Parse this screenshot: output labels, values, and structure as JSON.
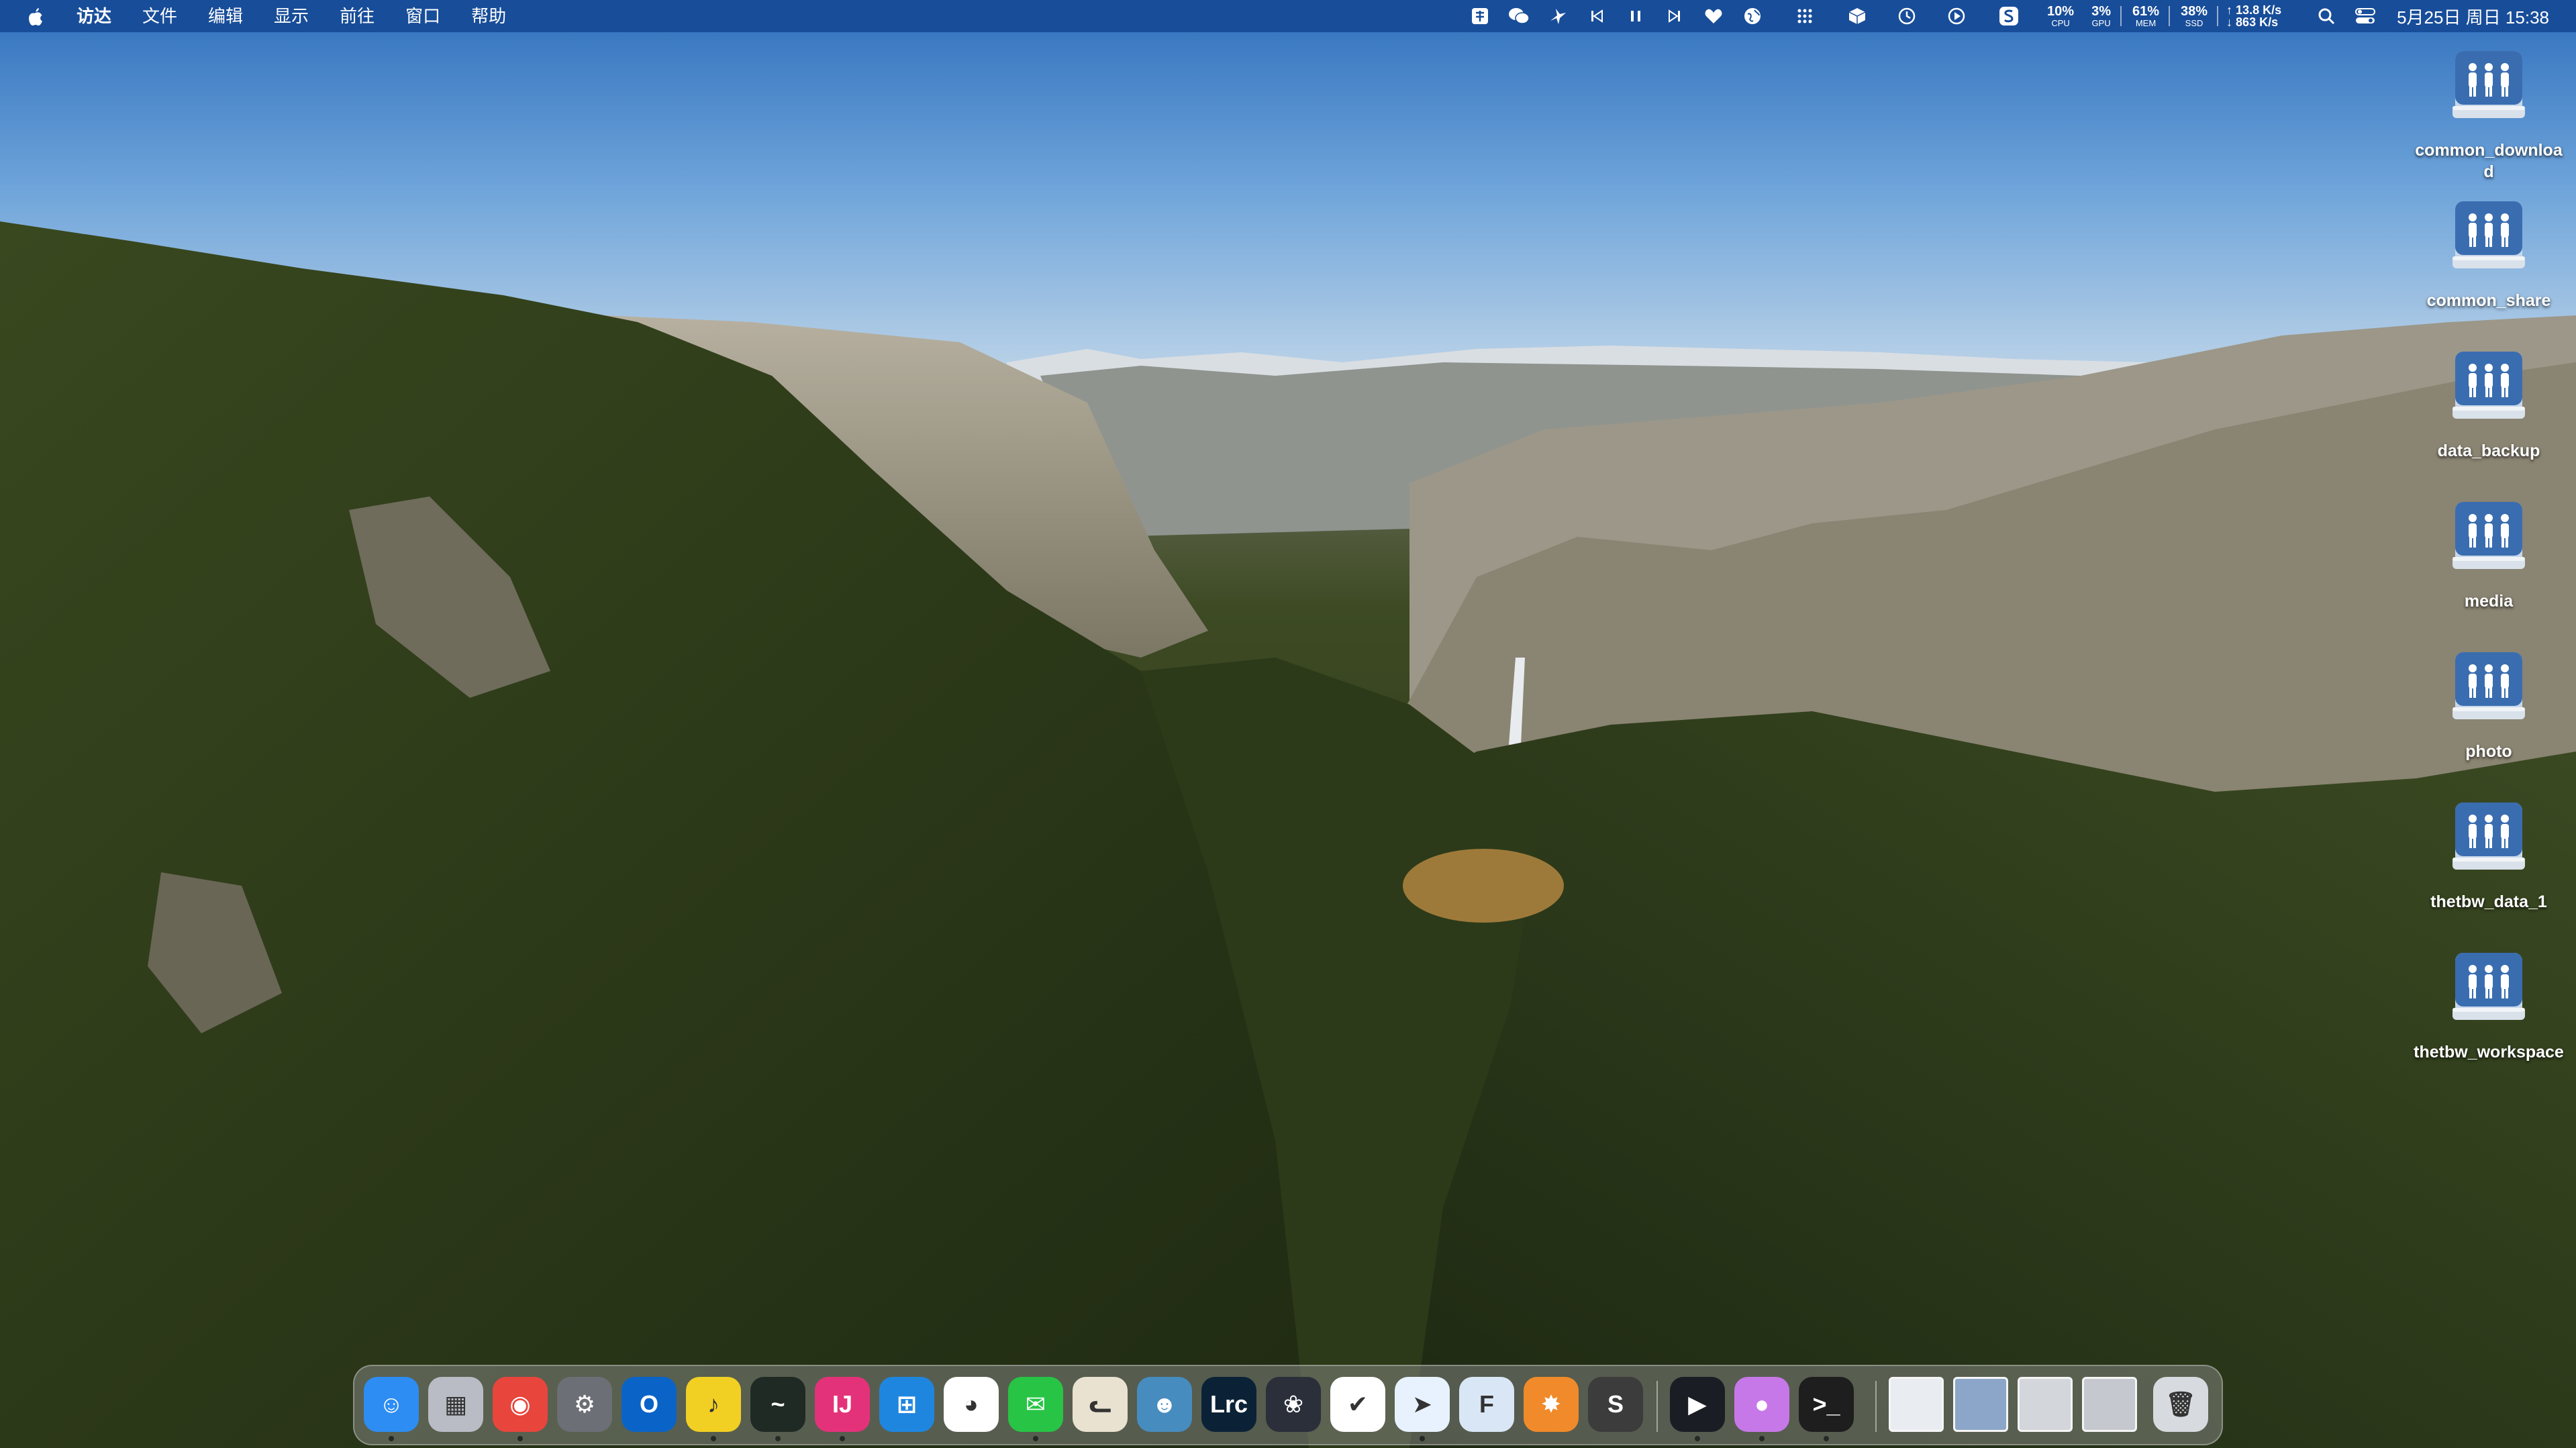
{
  "menubar": {
    "app_name": "访达",
    "items": [
      "文件",
      "编辑",
      "显示",
      "前往",
      "窗口",
      "帮助"
    ],
    "status_icons": [
      "input-method-icon",
      "wechat-icon",
      "bird-icon",
      "previous-track-icon",
      "pause-icon",
      "next-track-icon",
      "heart-icon",
      "globe-icon",
      "grid-icon",
      "cube-icon",
      "time-machine-icon",
      "play-circle-icon",
      "s-app-icon"
    ],
    "stats": [
      {
        "value": "10%",
        "label": "CPU"
      },
      {
        "value": "3%",
        "label": "GPU"
      },
      {
        "value": "61%",
        "label": "MEM"
      },
      {
        "value": "38%",
        "label": "SSD"
      }
    ],
    "net_up": "↑ 13.8 K/s",
    "net_down": "↓ 863 K/s",
    "clock": "5月25日 周日  15:38"
  },
  "desktop_icons": [
    {
      "label": "common_download",
      "icon": "network-drive-icon"
    },
    {
      "label": "common_share",
      "icon": "network-drive-icon"
    },
    {
      "label": "data_backup",
      "icon": "network-drive-icon"
    },
    {
      "label": "media",
      "icon": "network-drive-icon"
    },
    {
      "label": "photo",
      "icon": "network-drive-icon"
    },
    {
      "label": "thetbw_data_1",
      "icon": "network-drive-icon"
    },
    {
      "label": "thetbw_workspace",
      "icon": "network-drive-icon"
    }
  ],
  "dock": {
    "apps": [
      {
        "name": "finder",
        "glyph": "☺",
        "color": "#2d8df2",
        "running": true
      },
      {
        "name": "launchpad",
        "glyph": "▦",
        "color": "#b9bcc4",
        "running": false
      },
      {
        "name": "chrome",
        "glyph": "◉",
        "color": "#e8453c",
        "running": true
      },
      {
        "name": "system-settings",
        "glyph": "⚙",
        "color": "#6c6f75",
        "running": false
      },
      {
        "name": "outlook",
        "glyph": "O",
        "color": "#0a64c8",
        "running": false
      },
      {
        "name": "qq-music",
        "glyph": "♪",
        "color": "#f2d023",
        "running": true
      },
      {
        "name": "activity-monitor",
        "glyph": "~",
        "color": "#1f2a24",
        "running": true
      },
      {
        "name": "intellij-idea",
        "glyph": "IJ",
        "color": "#e4327a",
        "running": true
      },
      {
        "name": "windows-app",
        "glyph": "⊞",
        "color": "#1f86e0",
        "running": false
      },
      {
        "name": "qq",
        "glyph": "◕",
        "color": "#ffffff",
        "running": false
      },
      {
        "name": "wechat",
        "glyph": "✉",
        "color": "#28c445",
        "running": true
      },
      {
        "name": "cat-app",
        "glyph": "ᓚ",
        "color": "#e9e2d0",
        "running": false
      },
      {
        "name": "godot",
        "glyph": "☻",
        "color": "#478cbf",
        "running": false
      },
      {
        "name": "lightroom-classic",
        "glyph": "Lrc",
        "color": "#0b2236",
        "running": false
      },
      {
        "name": "davinci-resolve",
        "glyph": "❀",
        "color": "#2a2f3a",
        "running": false
      },
      {
        "name": "tasks",
        "glyph": "✔",
        "color": "#ffffff",
        "running": false
      },
      {
        "name": "feishu",
        "glyph": "➤",
        "color": "#e8f2ff",
        "running": true
      },
      {
        "name": "file-app",
        "glyph": "F",
        "color": "#d9e6f5",
        "running": false
      },
      {
        "name": "sublime-merge",
        "glyph": "✸",
        "color": "#f08a2a",
        "running": false
      },
      {
        "name": "sublime-text",
        "glyph": "S",
        "color": "#3c3c3c",
        "running": false
      },
      {
        "name": "infuse",
        "glyph": "▶",
        "color": "#1b1d24",
        "running": true
      },
      {
        "name": "shortcuts",
        "glyph": "●",
        "color": "#c778e8",
        "running": true
      },
      {
        "name": "terminal",
        "glyph": ">_",
        "color": "#1e1e1e",
        "running": true
      },
      {
        "name": "document-stack-1",
        "glyph": "",
        "color": "#e9edf2",
        "running": false
      },
      {
        "name": "document-stack-2",
        "glyph": "",
        "color": "#8ba6c9",
        "running": false
      },
      {
        "name": "screenshot-stack-1",
        "glyph": "",
        "color": "#d3d6da",
        "running": false
      },
      {
        "name": "screenshot-stack-2",
        "glyph": "",
        "color": "#c5c9cf",
        "running": false
      },
      {
        "name": "trash",
        "glyph": "🗑",
        "color": "#d7dade",
        "running": false
      }
    ]
  }
}
